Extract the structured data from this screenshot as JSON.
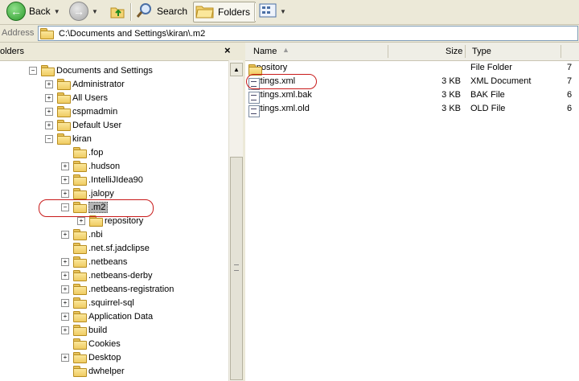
{
  "toolbar": {
    "back_label": "Back",
    "search_label": "Search",
    "folders_label": "Folders"
  },
  "address": {
    "label": "Address",
    "value": "C:\\Documents and Settings\\kiran\\.m2"
  },
  "folders_pane": {
    "title": "olders",
    "close_glyph": "×"
  },
  "tree": [
    {
      "label": "Documents and Settings",
      "expander": "−"
    },
    {
      "label": "Administrator",
      "expander": "+"
    },
    {
      "label": "All Users",
      "expander": "+"
    },
    {
      "label": "cspmadmin",
      "expander": "+"
    },
    {
      "label": "Default User",
      "expander": "+"
    },
    {
      "label": "kiran",
      "expander": "−"
    },
    {
      "label": ".fop",
      "expander": ""
    },
    {
      "label": ".hudson",
      "expander": "+"
    },
    {
      "label": ".IntelliJIdea90",
      "expander": "+"
    },
    {
      "label": ".jalopy",
      "expander": "+"
    },
    {
      "label": ".m2",
      "expander": "−",
      "selected": true
    },
    {
      "label": "repository",
      "expander": "+"
    },
    {
      "label": ".nbi",
      "expander": "+"
    },
    {
      "label": ".net.sf.jadclipse",
      "expander": ""
    },
    {
      "label": ".netbeans",
      "expander": "+"
    },
    {
      "label": ".netbeans-derby",
      "expander": "+"
    },
    {
      "label": ".netbeans-registration",
      "expander": "+"
    },
    {
      "label": ".squirrel-sql",
      "expander": "+"
    },
    {
      "label": "Application Data",
      "expander": "+"
    },
    {
      "label": "build",
      "expander": "+"
    },
    {
      "label": "Cookies",
      "expander": ""
    },
    {
      "label": "Desktop",
      "expander": "+"
    },
    {
      "label": "dwhelper",
      "expander": ""
    }
  ],
  "columns": {
    "name": "Name",
    "size": "Size",
    "type": "Type"
  },
  "files": [
    {
      "name": "repository",
      "size": "",
      "type": "File Folder",
      "extra": "7",
      "icon": "folder-icon"
    },
    {
      "name": "settings.xml",
      "size": "3 KB",
      "type": "XML Document",
      "extra": "7",
      "icon": "xml-document-icon"
    },
    {
      "name": "settings.xml.bak",
      "size": "3 KB",
      "type": "BAK File",
      "extra": "6",
      "icon": "bak-file-icon"
    },
    {
      "name": "settings.xml.old",
      "size": "3 KB",
      "type": "OLD File",
      "extra": "6",
      "icon": "old-file-icon"
    }
  ]
}
